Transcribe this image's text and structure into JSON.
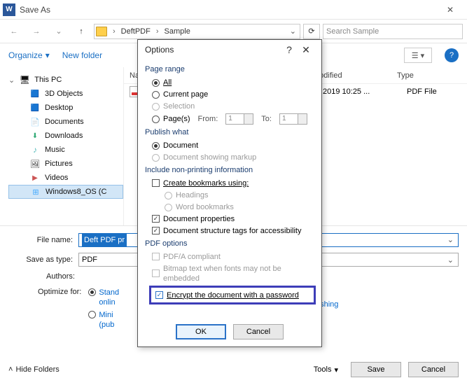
{
  "titlebar": {
    "app_glyph": "W",
    "title": "Save As"
  },
  "nav": {
    "crumbs": [
      "DeftPDF",
      "Sample"
    ],
    "search_placeholder": "Search Sample"
  },
  "toolbar": {
    "organize": "Organize",
    "new_folder": "New folder"
  },
  "sidebar": {
    "this_pc": "This PC",
    "items": [
      {
        "label": "3D Objects",
        "icon": "cube"
      },
      {
        "label": "Desktop",
        "icon": "desk"
      },
      {
        "label": "Documents",
        "icon": "doc"
      },
      {
        "label": "Downloads",
        "icon": "dl"
      },
      {
        "label": "Music",
        "icon": "music"
      },
      {
        "label": "Pictures",
        "icon": "pic"
      },
      {
        "label": "Videos",
        "icon": "vid"
      },
      {
        "label": "Windows8_OS (C",
        "icon": "disk"
      }
    ]
  },
  "files": {
    "cols": {
      "name": "Na",
      "modified": "modified",
      "type": "Type"
    },
    "rows": [
      {
        "name": "",
        "modified": "2019 10:25 ...",
        "type": "PDF File"
      }
    ]
  },
  "form": {
    "filename_label": "File name:",
    "filename_value": "Deft PDF pr",
    "type_label": "Save as type:",
    "type_value": "PDF",
    "authors_label": "Authors:",
    "optimize_label": "Optimize for:",
    "optimize_std_a": "Stand",
    "optimize_std_b": "onlin",
    "optimize_min_a": "Mini",
    "optimize_min_b": "(pub",
    "publishing_link": "ublishing",
    "options_btn": "..."
  },
  "bottom": {
    "hide_folders": "Hide Folders",
    "tools": "Tools",
    "save": "Save",
    "cancel": "Cancel"
  },
  "modal": {
    "title": "Options",
    "help": "?",
    "close": "✕",
    "page_range": {
      "head": "Page range",
      "all": "All",
      "current": "Current page",
      "selection": "Selection",
      "pages": "Page(s)",
      "from": "From:",
      "to": "To:",
      "from_val": "1",
      "to_val": "1"
    },
    "publish": {
      "head": "Publish what",
      "doc": "Document",
      "markup": "Document showing markup"
    },
    "nonprint": {
      "head": "Include non-printing information",
      "bookmarks": "Create bookmarks using:",
      "headings": "Headings",
      "word_bm": "Word bookmarks",
      "props": "Document properties",
      "tags": "Document structure tags for accessibility"
    },
    "pdfopt": {
      "head": "PDF options",
      "pdfa": "PDF/A compliant",
      "bitmap": "Bitmap text when fonts may not be embedded",
      "encrypt": "Encrypt the document with a password"
    },
    "ok": "OK",
    "cancel": "Cancel"
  }
}
